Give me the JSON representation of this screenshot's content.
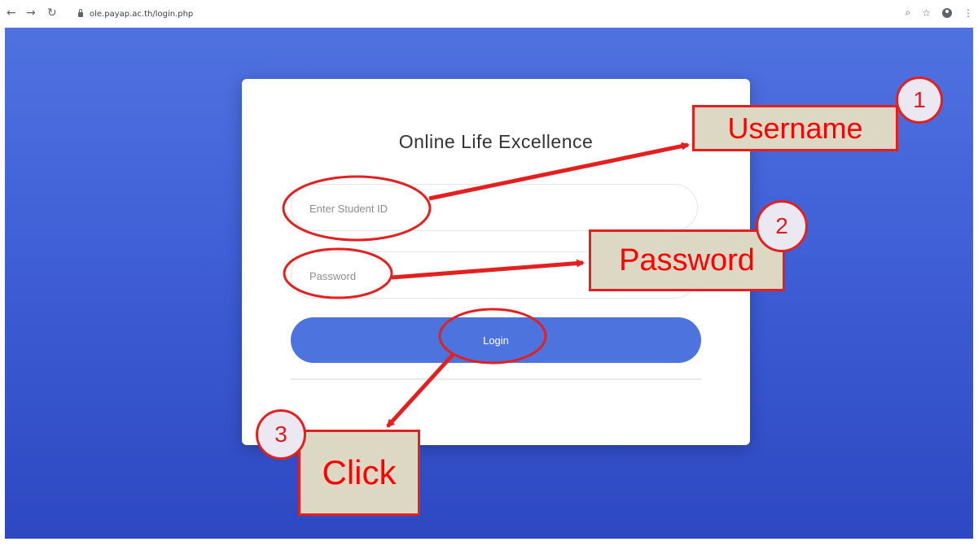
{
  "browser": {
    "back_icon": "back-arrow-icon",
    "forward_icon": "forward-arrow-icon",
    "reload_icon": "reload-icon",
    "url": "ole.payap.ac.th/login.php"
  },
  "login": {
    "title": "Online Life Excellence",
    "username_placeholder": "Enter Student ID",
    "password_placeholder": "Password",
    "login_label": "Login"
  },
  "annotations": [
    {
      "number": "1",
      "label": "Username"
    },
    {
      "number": "2",
      "label": "Password"
    },
    {
      "number": "3",
      "label": "Click"
    }
  ],
  "colors": {
    "background_top": "#4f72e0",
    "background_bottom": "#2d48c2",
    "button": "#4d73de",
    "annotation_red": "#e32020",
    "annotation_box": "#ddd8c3",
    "annotation_circle": "#ece8f2"
  }
}
